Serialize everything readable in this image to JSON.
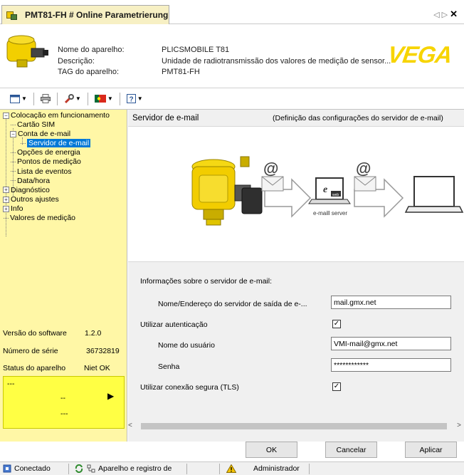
{
  "tab": {
    "title": "PMT81-FH # Online Parametrierung"
  },
  "header": {
    "labels": [
      "Nome do aparelho:",
      "Descrição:",
      "TAG do aparelho:"
    ],
    "values": [
      "PLICSMOBILE T81",
      "Unidade de radiotransmissão dos valores de medição de sensor...",
      "PMT81-FH"
    ],
    "logo": "VEGA"
  },
  "tree": {
    "root": "Colocação em funcionamento",
    "sim": "Cartão SIM",
    "email_account": "Conta de e-mail",
    "email_server": "Servidor de e-mail",
    "energy": "Opções de energia",
    "points": "Pontos de medição",
    "events": "Lista de eventos",
    "datetime": "Data/hora",
    "diag": "Diagnóstico",
    "other": "Outros ajustes",
    "info": "Info",
    "values": "Valores de medição"
  },
  "device_info": {
    "software_label": "Versão do software",
    "software_value": "1.2.0",
    "serial_label": "Número de série",
    "serial_value": "36732819",
    "status_label": "Status do aparelho",
    "status_value": "Niet OK",
    "box_line1": "---",
    "box_line2": "--",
    "box_line3": "---"
  },
  "content": {
    "title": "Servidor de e-mail",
    "description": "(Definição das configurações do servidor de e-mail)",
    "illus_server_label": "e-maill server",
    "illus_web": "web",
    "section_label": "Informações sobre o servidor de e-mail:",
    "outgoing_label": "Nome/Endereço do  servidor de saída de e-...",
    "outgoing_value": "mail.gmx.net",
    "auth_label": "Utilizar autenticação",
    "auth_checked": true,
    "user_label": "Nome do usuário",
    "user_value": "VMI-mail@gmx.net",
    "password_label": "Senha",
    "password_value": "************",
    "tls_label": "Utilizar conexão segura (TLS)",
    "tls_checked": true,
    "check_mark": "✓"
  },
  "buttons": {
    "ok": "OK",
    "cancel": "Cancelar",
    "apply": "Aplicar"
  },
  "statusbar": {
    "connected": "Conectado",
    "device_reg": "Aparelho e registro de",
    "admin": "Administrador"
  },
  "colors": {
    "left_panel": "#fff7a6",
    "status_box": "#ffff44",
    "selection": "#0078d7",
    "logo": "#f7d400"
  }
}
